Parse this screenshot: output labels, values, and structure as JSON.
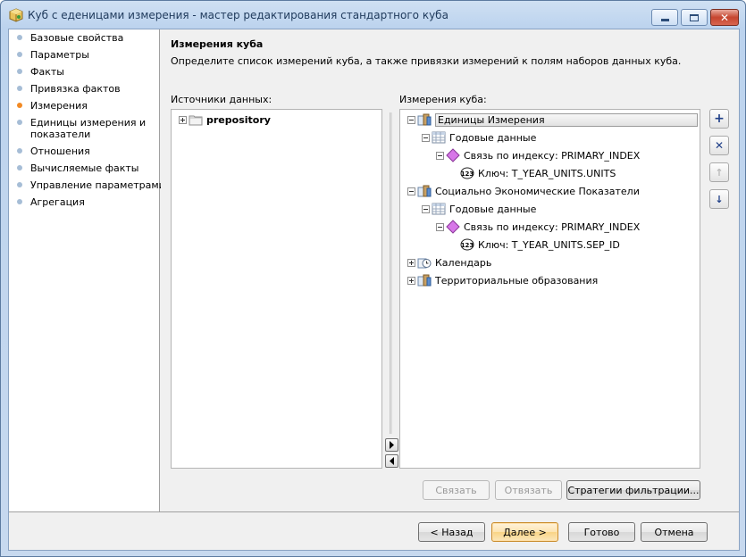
{
  "window": {
    "title": "Куб с еденицами измерения - мастер редактирования стандартного куба",
    "icon": "cube-wizard-icon"
  },
  "nav": {
    "items": [
      {
        "label": "Базовые свойства",
        "active": false
      },
      {
        "label": "Параметры",
        "active": false
      },
      {
        "label": "Факты",
        "active": false
      },
      {
        "label": "Привязка фактов",
        "active": false
      },
      {
        "label": "Измерения",
        "active": true
      },
      {
        "label": "Единицы измерения и",
        "label2": "показатели",
        "active": false
      },
      {
        "label": "Отношения",
        "active": false
      },
      {
        "label": "Вычисляемые факты",
        "active": false
      },
      {
        "label": "Управление параметрами",
        "active": false
      },
      {
        "label": "Агрегация",
        "active": false
      }
    ],
    "active_color": "#f28a24",
    "bullet_color": "#a6bdd6"
  },
  "page": {
    "title": "Измерения куба",
    "description": "Определите список измерений куба, а также привязки измерений к полям наборов данных куба."
  },
  "sources": {
    "label": "Источники данных:",
    "items": [
      {
        "label": "prepository",
        "icon": "folder-icon"
      }
    ]
  },
  "dimensions": {
    "label": "Измерения куба:",
    "rows": [
      {
        "label": "Единицы Измерения",
        "icon": "dimension-book-icon"
      },
      {
        "label": "Годовые данные",
        "icon": "table-icon"
      },
      {
        "label": "Связь по индексу: PRIMARY_INDEX",
        "icon": "index-diamond-icon"
      },
      {
        "label": "Ключ: T_YEAR_UNITS.UNITS",
        "icon": "numeric-key-icon"
      },
      {
        "label": "Социально Экономические Показатели",
        "icon": "dimension-book-icon"
      },
      {
        "label": "Годовые данные",
        "icon": "table-icon"
      },
      {
        "label": "Связь по индексу: PRIMARY_INDEX",
        "icon": "index-diamond-icon"
      },
      {
        "label": "Ключ: T_YEAR_UNITS.SEP_ID",
        "icon": "numeric-key-icon"
      },
      {
        "label": "Календарь",
        "icon": "calendar-dimension-icon"
      },
      {
        "label": "Территориальные образования",
        "icon": "dimension-book-icon"
      }
    ]
  },
  "side_buttons": {
    "add_icon": "+",
    "delete_icon": "✕",
    "up_icon": "↑",
    "down_icon": "↓"
  },
  "actions": {
    "link": "Связать",
    "unlink": "Отвязать",
    "filter_strategies": "Стратегии фильтрации..."
  },
  "footer": {
    "back": "< Назад",
    "next": "Далее >",
    "finish": "Готово",
    "cancel": "Отмена"
  }
}
